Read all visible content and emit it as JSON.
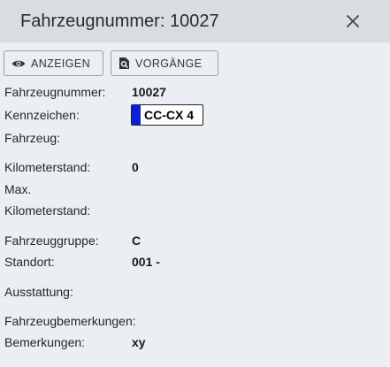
{
  "dialog": {
    "title": "Fahrzeugnummer: 10027",
    "close_icon": "close-icon"
  },
  "toolbar": {
    "show_label": "ANZEIGEN",
    "show_icon": "eye-icon",
    "procedures_label": "VORGÄNGE",
    "procedures_icon": "document-search-icon"
  },
  "details": {
    "vehicle_number_label": "Fahrzeugnummer:",
    "vehicle_number_value": "10027",
    "plate_label_line1": "Kennzeichen:",
    "plate_label_line2": "Fahrzeug:",
    "plate_value": "CC-CX 4",
    "plate_strip_color": "#0a1fd8",
    "mileage_label": "Kilometerstand:",
    "mileage_value": "0",
    "max_mileage_label_line1": "Max.",
    "max_mileage_label_line2": "Kilometerstand:",
    "vehicle_group_label": "Fahrzeuggruppe:",
    "vehicle_group_value": "C",
    "location_label": "Standort:",
    "location_value": "001 -",
    "equipment_label": "Ausstattung:",
    "vehicle_remarks_label": "Fahrzeugbemerkungen:",
    "remarks_label": "Bemerkungen:",
    "remarks_value": "xy"
  }
}
